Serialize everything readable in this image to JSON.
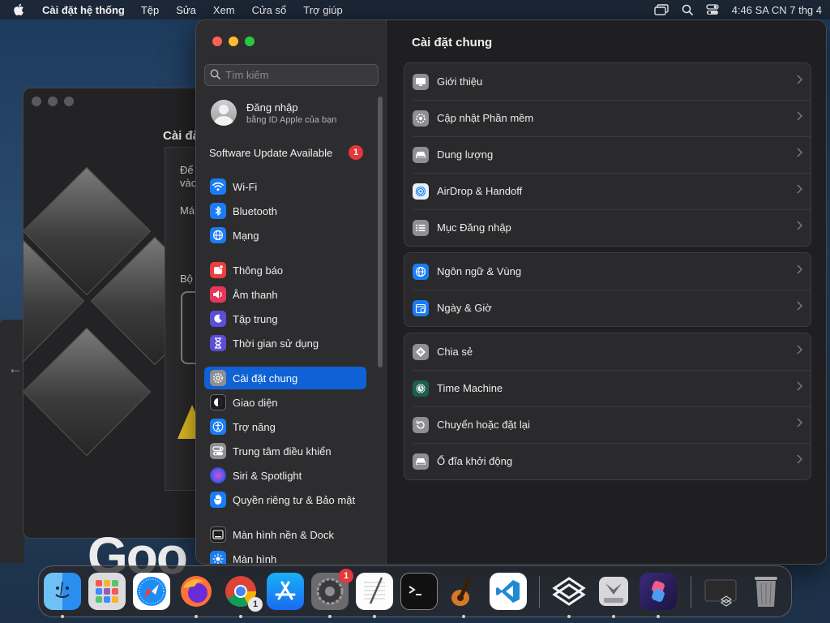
{
  "menubar": {
    "app_name": "Cài đặt hệ thống",
    "items": [
      "Tệp",
      "Sửa",
      "Xem",
      "Cửa sổ",
      "Trợ giúp"
    ],
    "clock": "4:46 SA CN 7 thg 4"
  },
  "background_window": {
    "title": "Cài đặ",
    "lines": [
      "Để",
      "vào",
      "Má",
      "Bộ"
    ],
    "google_fragment": "Goo"
  },
  "sidebar": {
    "search_placeholder": "Tìm kiếm",
    "account": {
      "name": "Đăng nhập",
      "subtitle": "bằng ID Apple của bạn"
    },
    "update": {
      "label": "Software Update Available",
      "count": "1"
    },
    "items": [
      {
        "label": "Wi-Fi",
        "icon": "wifi-icon",
        "color": "#1a7cf5"
      },
      {
        "label": "Bluetooth",
        "icon": "bluetooth-icon",
        "color": "#1a7cf5"
      },
      {
        "label": "Mạng",
        "icon": "globe-icon",
        "color": "#1a7cf5"
      },
      {
        "label": "Thông báo",
        "icon": "bell-icon",
        "color": "#ec4040"
      },
      {
        "label": "Âm thanh",
        "icon": "speaker-icon",
        "color": "#e8365a"
      },
      {
        "label": "Tập trung",
        "icon": "moon-icon",
        "color": "#5a4fd6"
      },
      {
        "label": "Thời gian sử dụng",
        "icon": "hourglass-icon",
        "color": "#5a4fd6"
      },
      {
        "label": "Cài đặt chung",
        "icon": "gear-icon",
        "color": "#8e8e93",
        "selected": true
      },
      {
        "label": "Giao diện",
        "icon": "appearance-icon",
        "color": "#1c1c1e"
      },
      {
        "label": "Trợ năng",
        "icon": "accessibility-icon",
        "color": "#1a7cf5"
      },
      {
        "label": "Trung tâm điều khiển",
        "icon": "control-center-icon",
        "color": "#8e8e93"
      },
      {
        "label": "Siri & Spotlight",
        "icon": "siri-icon",
        "color": "#2b2b6e"
      },
      {
        "label": "Quyền riêng tư & Bảo mật",
        "icon": "hand-icon",
        "color": "#1a7cf5"
      },
      {
        "label": "Màn hình nền & Dock",
        "icon": "dock-icon",
        "color": "#1c1c1e"
      },
      {
        "label": "Màn hình",
        "icon": "sun-icon",
        "color": "#1a7cf5"
      }
    ]
  },
  "main": {
    "title": "Cài đặt chung",
    "groups": [
      [
        {
          "label": "Giới thiệu",
          "icon": "display-icon"
        },
        {
          "label": "Cập nhật Phần mềm",
          "icon": "gear-badge-icon"
        },
        {
          "label": "Dung lượng",
          "icon": "drive-icon"
        },
        {
          "label": "AirDrop & Handoff",
          "icon": "airdrop-icon"
        },
        {
          "label": "Mục Đăng nhập",
          "icon": "list-icon"
        }
      ],
      [
        {
          "label": "Ngôn ngữ & Vùng",
          "icon": "globe-icon"
        },
        {
          "label": "Ngày & Giờ",
          "icon": "calendar-clock-icon"
        }
      ],
      [
        {
          "label": "Chia sẻ",
          "icon": "share-icon"
        },
        {
          "label": "Time Machine",
          "icon": "time-machine-icon"
        },
        {
          "label": "Chuyển hoặc đặt lại",
          "icon": "reset-icon"
        },
        {
          "label": "Ổ đĩa khởi động",
          "icon": "startup-disk-icon"
        }
      ]
    ]
  },
  "dock": {
    "apps": [
      {
        "name": "Finder",
        "icon": "finder-icon",
        "running": true
      },
      {
        "name": "Launchpad",
        "icon": "launchpad-icon",
        "running": false
      },
      {
        "name": "Safari",
        "icon": "safari-icon",
        "running": false
      },
      {
        "name": "Firefox",
        "icon": "firefox-icon",
        "running": true
      },
      {
        "name": "Chrome",
        "icon": "chrome-icon",
        "running": true,
        "badge": "1"
      },
      {
        "name": "App Store",
        "icon": "app-store-icon",
        "running": false
      },
      {
        "name": "System Settings",
        "icon": "system-settings-icon",
        "running": true,
        "badge": "1"
      },
      {
        "name": "TextEdit",
        "icon": "textedit-icon",
        "running": true
      },
      {
        "name": "Terminal",
        "icon": "terminal-icon",
        "running": false
      },
      {
        "name": "GarageBand",
        "icon": "garageband-icon",
        "running": true
      },
      {
        "name": "VS Code",
        "icon": "vscode-icon",
        "running": false
      },
      {
        "name": "Parallels",
        "icon": "parallels-icon",
        "running": true
      },
      {
        "name": "Disk Utility",
        "icon": "disk-utility-icon",
        "running": true
      },
      {
        "name": "Shortcuts",
        "icon": "shortcuts-icon",
        "running": true
      },
      {
        "name": "Downloads",
        "icon": "downloads-stack-icon",
        "running": false
      },
      {
        "name": "Trash",
        "icon": "trash-icon",
        "running": false
      }
    ]
  }
}
